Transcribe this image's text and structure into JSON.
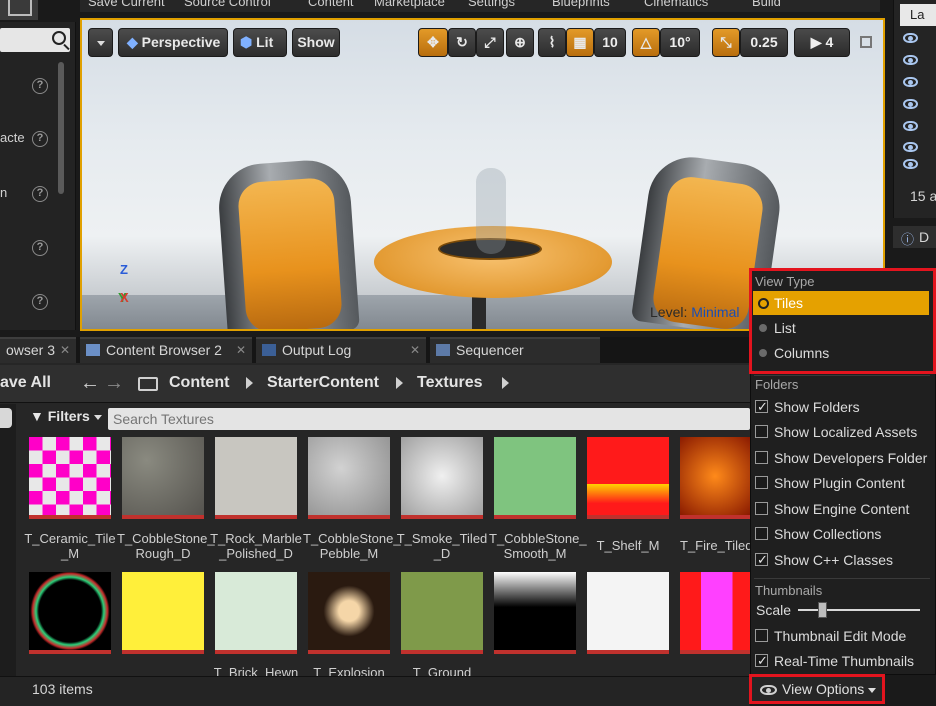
{
  "top_menu": [
    "Save Current",
    "Source Control",
    "Content",
    "Marketplace",
    "Settings",
    "Blueprints",
    "Cinematics",
    "Build"
  ],
  "details_panel": {
    "labels": [
      "",
      "acte",
      "n",
      "",
      ""
    ]
  },
  "viewport": {
    "view_mode": "Perspective",
    "lighting": "Lit",
    "show": "Show",
    "grid_snap": "10",
    "rotation_snap": "10°",
    "scale_snap": "0.25",
    "camera_speed": "4",
    "level_label": "Level:",
    "level_name": "Minimal",
    "axis_x": "X",
    "axis_y": "Y",
    "axis_z": "Z"
  },
  "outliner": {
    "count_text": "15 a",
    "header": "La",
    "bottom_tab": "D"
  },
  "tabs": [
    {
      "label": "owser 3"
    },
    {
      "label": "Content Browser 2"
    },
    {
      "label": "Output Log"
    },
    {
      "label": "Sequencer"
    }
  ],
  "content_browser": {
    "save_all": "ave All",
    "breadcrumb": [
      "Content",
      "StarterContent",
      "Textures"
    ],
    "filters_label": "Filters",
    "search_placeholder": "Search Textures",
    "item_count": "103 items",
    "assets_row1": [
      {
        "name": "T_Ceramic_Tile_M",
        "line1": "T_Ceramic_Tile",
        "line2": "_M"
      },
      {
        "name": "T_CobbleStone_Rough_D",
        "line1": "T_CobbleStone_",
        "line2": "Rough_D"
      },
      {
        "name": "T_Rock_Marble_Polished_D",
        "line1": "T_Rock_Marble",
        "line2": "_Polished_D"
      },
      {
        "name": "T_CobbleStone_Pebble_M",
        "line1": "T_CobbleStone_",
        "line2": "Pebble_M"
      },
      {
        "name": "T_Smoke_Tiled_D",
        "line1": "T_Smoke_Tiled",
        "line2": "_D"
      },
      {
        "name": "T_CobbleStone_Smooth_M",
        "line1": "T_CobbleStone_",
        "line2": "Smooth_M"
      },
      {
        "name": "T_Shelf_M",
        "line1": "T_Shelf_M",
        "line2": ""
      },
      {
        "name": "T_Fire_Tiled_",
        "line1": "T_Fire_Tiled_",
        "line2": ""
      }
    ],
    "assets_row2_partial_labels": [
      "T_Brick_Hewn",
      "T_Explosion",
      "T_Ground"
    ]
  },
  "view_options": {
    "button_label": "View Options",
    "view_type_header": "View Type",
    "view_types": [
      "Tiles",
      "List",
      "Columns"
    ],
    "selected_view_type": "Tiles",
    "folders_header": "Folders",
    "folder_options": [
      {
        "label": "Show Folders",
        "checked": true
      },
      {
        "label": "Show Localized Assets",
        "checked": false
      },
      {
        "label": "Show Developers Folder",
        "checked": false
      },
      {
        "label": "Show Plugin Content",
        "checked": false
      },
      {
        "label": "Show Engine Content",
        "checked": false
      },
      {
        "label": "Show Collections",
        "checked": false
      },
      {
        "label": "Show C++ Classes",
        "checked": true
      }
    ],
    "thumbnails_header": "Thumbnails",
    "scale_label": "Scale",
    "scale_value": 0.2,
    "thumbnail_options": [
      {
        "label": "Thumbnail Edit Mode",
        "checked": false
      },
      {
        "label": "Real-Time Thumbnails",
        "checked": true
      }
    ]
  },
  "colors": {
    "accent": "#e5a100",
    "highlight": "#e3141e",
    "panel": "#262626"
  }
}
